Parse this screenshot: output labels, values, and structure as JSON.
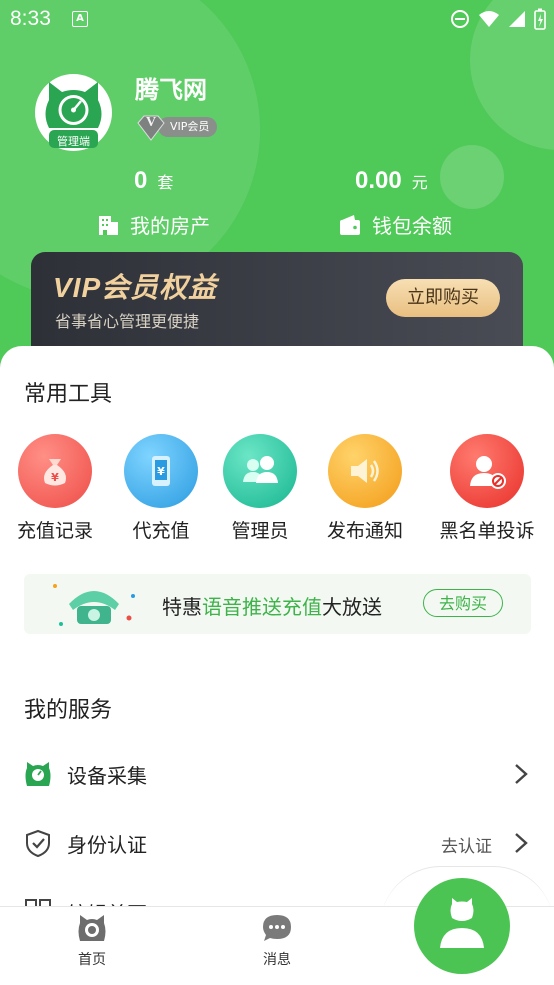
{
  "status_bar": {
    "time": "8:33",
    "a_icon": "A"
  },
  "profile": {
    "avatar_label": "管理端",
    "name": "腾飞网",
    "vip_label": "VIP会员",
    "vip_gem": "V"
  },
  "stats": {
    "property_count": "0",
    "property_unit": "套",
    "property_label": "我的房产",
    "wallet_amount": "0.00",
    "wallet_unit": "元",
    "wallet_label": "钱包余额"
  },
  "vip_card": {
    "title": "VIP会员权益",
    "subtitle": "省事省心管理更便捷",
    "buy_label": "立即购买"
  },
  "tools": {
    "title": "常用工具",
    "items": [
      {
        "label": "充值记录",
        "icon": "money-bag-icon",
        "color": "#f0544e"
      },
      {
        "label": "代充值",
        "icon": "phone-yuan-icon",
        "color": "#2aa5e4"
      },
      {
        "label": "管理员",
        "icon": "users-icon",
        "color": "#1fbf9c"
      },
      {
        "label": "发布通知",
        "icon": "speaker-icon",
        "color": "#f5a21c"
      },
      {
        "label": "黑名单投诉",
        "icon": "user-block-icon",
        "color": "#ee3a32"
      }
    ]
  },
  "promo": {
    "prefix": "特惠",
    "highlight": "语音推送充值",
    "suffix": "大放送",
    "button": "去购买"
  },
  "services": {
    "title": "我的服务",
    "items": [
      {
        "label": "设备采集",
        "hint": "",
        "icon": "cat-gauge-icon"
      },
      {
        "label": "身份认证",
        "hint": "去认证",
        "icon": "shield-check-icon"
      },
      {
        "label": "编辑首页",
        "hint": "",
        "icon": "grid-icon"
      }
    ]
  },
  "tabbar": {
    "home": "首页",
    "messages": "消息"
  },
  "colors": {
    "brand_green": "#4fc957",
    "accent_green": "#3db34a",
    "vip_gold": "#f1d19e"
  }
}
